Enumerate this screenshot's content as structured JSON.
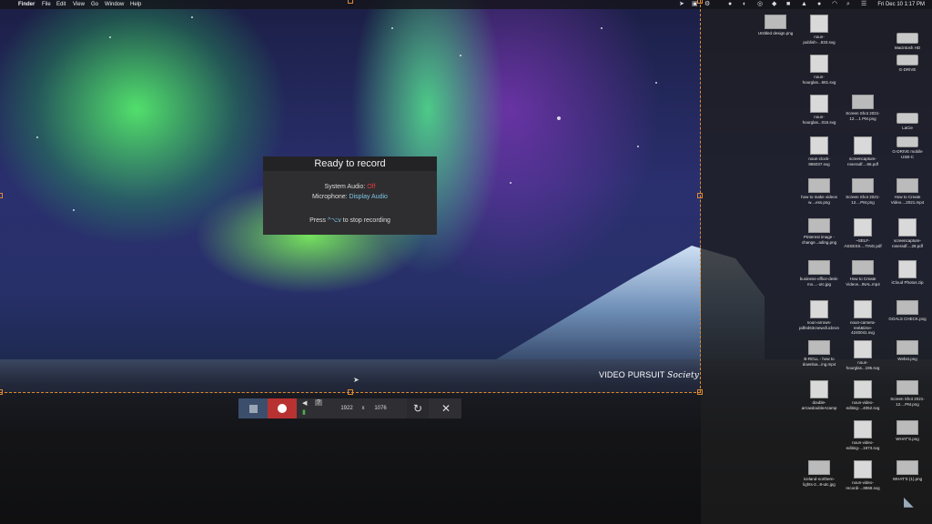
{
  "menubar": {
    "app_menus": [
      "Finder",
      "File",
      "Edit",
      "View",
      "Go",
      "Window",
      "Help"
    ],
    "clock": "Fri Dec 10  1:17 PM"
  },
  "dialog": {
    "title": "Ready to record",
    "system_audio_label": "System Audio:",
    "system_audio_value": "Off",
    "microphone_label": "Microphone:",
    "microphone_value": "Display Audio",
    "hint_prefix": "Press",
    "hint_key": "^⌥v",
    "hint_suffix": "to stop recording",
    "colors": {
      "off": "#e23b3b",
      "mic": "#7ec6e8"
    }
  },
  "watermark": {
    "text": "VIDEO PURSUIT",
    "script": "Society"
  },
  "toolbar": {
    "width": "1922",
    "times": "x",
    "height": "1076",
    "reset_icon": "↻",
    "close_icon": "✕",
    "help": "?"
  },
  "desktop_icons": [
    {
      "label": "Untitled design.png"
    },
    {
      "label": "noun-publish-...833.svg"
    },
    {
      "label": "Macintosh HD"
    },
    {
      "label": "noun-hourglas...681.svg"
    },
    {
      "label": "G-DRIVE"
    },
    {
      "label": "noun-hourglas...016.svg"
    },
    {
      "label": "Screen Shot 2021-12....1 PM.png"
    },
    {
      "label": "LaCie"
    },
    {
      "label": "noun-clock-886037.svg"
    },
    {
      "label": "screencapture-roseradf....66.pdf"
    },
    {
      "label": "G-DRIVE mobile USB-C"
    },
    {
      "label": "how to make videos w....ess.png"
    },
    {
      "label": "Screen Shot 2021-12....PM.png"
    },
    {
      "label": "How to Create Video....2021.mp4"
    },
    {
      "label": "Pinterest image - change...ading.png"
    },
    {
      "label": "~SELF-ASSESS....TING.pdf"
    },
    {
      "label": "screencapture-roseradf....28.pdf"
    },
    {
      "label": "business-office-desk-mo....-utc.jpg"
    },
    {
      "label": "How to Create Videos...INAL.mp4"
    },
    {
      "label": "iCloud Photos.zip"
    },
    {
      "label": "noun-arrows-pdfed63cnewcfucbron"
    },
    {
      "label": "noun-camera-reel&time-4240041.svg"
    },
    {
      "label": "GOALS CHECK.png"
    },
    {
      "label": "B-ROLL - how to downloa...ing.mp4"
    },
    {
      "label": "noun-hourglas...195.svg"
    },
    {
      "label": "Webst.png"
    },
    {
      "label": "double-arrowdoubleAzamp"
    },
    {
      "label": "noun-video-editing-...4052.svg"
    },
    {
      "label": "Screen Shot 2021-12....PM.png"
    },
    {
      "label": "noun-video-editing-...1973.svg"
    },
    {
      "label": "WHAT'S.png"
    },
    {
      "label": "iceland-northern-lights-2...8-utc.jpg"
    },
    {
      "label": "noun-video-recordi-...8868.svg"
    },
    {
      "label": "WHAT'S (1).png"
    }
  ]
}
